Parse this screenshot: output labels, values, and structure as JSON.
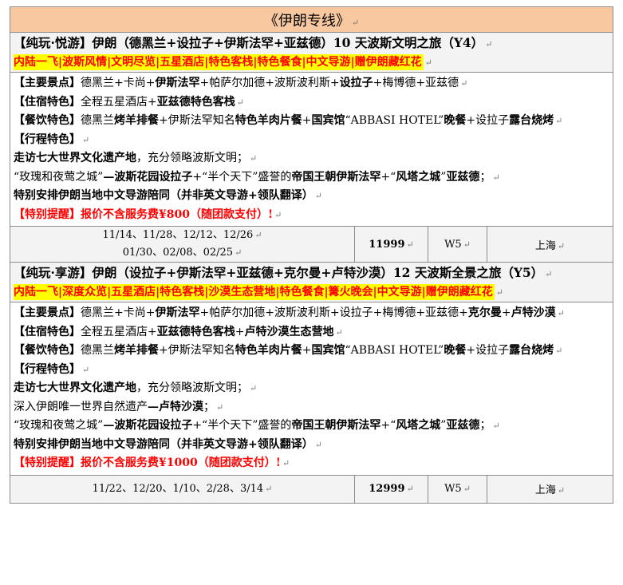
{
  "return_mark": "↵",
  "title": "《伊朗专线》",
  "tours": [
    {
      "name": "【纯玩·悦游】伊朗（德黑兰+设拉子+伊斯法罕+亚兹德）10 天波斯文明之旅（Y4）",
      "highlights": "内陆一飞|波斯风情|文明尽览|五星酒店|特色客栈|特色餐食|中文导游|赠伊朗藏红花",
      "lines": [
        {
          "parts": [
            {
              "t": "【主要景点】",
              "b": true
            },
            {
              "t": "德黑兰+卡尚+"
            },
            {
              "t": "伊斯法罕",
              "b": true
            },
            {
              "t": "+帕萨尔加德+波斯波利斯+"
            },
            {
              "t": "设拉子",
              "b": true
            },
            {
              "t": "+梅博德+亚兹德"
            }
          ]
        },
        {
          "parts": [
            {
              "t": "【住宿特色】",
              "b": true
            },
            {
              "t": "全程五星酒店+"
            },
            {
              "t": "亚兹德特色客栈",
              "b": true
            }
          ]
        },
        {
          "parts": [
            {
              "t": "【餐饮特色】",
              "b": true
            },
            {
              "t": "德黑兰"
            },
            {
              "t": "烤羊排餐",
              "b": true
            },
            {
              "t": "+伊斯法罕知名"
            },
            {
              "t": "特色羊肉片餐",
              "b": true
            },
            {
              "t": "+"
            },
            {
              "t": "国宾馆",
              "b": true
            },
            {
              "t": "“ABBASI HOTEL”"
            },
            {
              "t": "晚餐",
              "b": true
            },
            {
              "t": "+设拉子"
            },
            {
              "t": "露台烧烤",
              "b": true
            }
          ],
          "wrap": true
        },
        {
          "parts": [
            {
              "t": "【行程特色】",
              "b": true
            }
          ]
        },
        {
          "parts": [
            {
              "t": "走访七大世界文化遗产地",
              "b": true
            },
            {
              "t": "，充分领略波斯文明；"
            }
          ]
        },
        {
          "parts": [
            {
              "t": "“玫瑰和夜莺之城”"
            },
            {
              "t": "—波斯花园设拉子",
              "b": true
            },
            {
              "t": "+“半个天下”盛誉的"
            },
            {
              "t": "帝国王朝伊斯法罕",
              "b": true
            },
            {
              "t": "+“"
            },
            {
              "t": "风塔之城",
              "b": true
            },
            {
              "t": "”"
            },
            {
              "t": "亚兹德",
              "b": true
            },
            {
              "t": "；"
            }
          ]
        },
        {
          "parts": [
            {
              "t": "特别安排伊朗当地中文导游陪同（并非英文导游+领队翻译）",
              "b": true
            }
          ]
        },
        {
          "parts": [
            {
              "t": "【特别提醒】报价不含服务费¥800（随团款支付）!",
              "r": true
            }
          ]
        }
      ],
      "dates": [
        "11/14、11/28、12/12、12/26",
        "01/30、02/08、02/25"
      ],
      "price": "11999",
      "week": "W5",
      "city": "上海"
    },
    {
      "name": "【纯玩·享游】伊朗（设拉子+伊斯法罕+亚兹德+克尔曼+卢特沙漠）12 天波斯全景之旅（Y5）",
      "highlights": "内陆一飞|深度众览|五星酒店|特色客栈|沙漠生态营地|特色餐食|篝火晚会|中文导游|赠伊朗藏红花",
      "lines": [
        {
          "parts": [
            {
              "t": "【主要景点】",
              "b": true
            },
            {
              "t": "德黑兰+卡尚+"
            },
            {
              "t": "伊斯法罕",
              "b": true
            },
            {
              "t": "+帕萨尔加德+波斯波利斯+设拉子+梅博德+亚兹德+"
            },
            {
              "t": "克尔曼",
              "b": true
            },
            {
              "t": "+"
            },
            {
              "t": "卢特沙漠",
              "b": true
            }
          ]
        },
        {
          "parts": [
            {
              "t": "【住宿特色】",
              "b": true
            },
            {
              "t": "全程五星酒店+"
            },
            {
              "t": "亚兹德特色客栈",
              "b": true
            },
            {
              "t": "+"
            },
            {
              "t": "卢特沙漠生态营地",
              "b": true
            }
          ]
        },
        {
          "parts": [
            {
              "t": "【餐饮特色】",
              "b": true
            },
            {
              "t": "德黑兰"
            },
            {
              "t": "烤羊排餐",
              "b": true
            },
            {
              "t": "+伊斯法罕知名"
            },
            {
              "t": "特色羊肉片餐",
              "b": true
            },
            {
              "t": "+"
            },
            {
              "t": "国宾馆",
              "b": true
            },
            {
              "t": "“ABBASI HOTEL”"
            },
            {
              "t": "晚餐",
              "b": true
            },
            {
              "t": "+设拉子"
            },
            {
              "t": "露台烧烤",
              "b": true
            }
          ],
          "wrap": true
        },
        {
          "parts": [
            {
              "t": "【行程特色】",
              "b": true
            }
          ]
        },
        {
          "parts": [
            {
              "t": "走访七大世界文化遗产地",
              "b": true
            },
            {
              "t": "，充分领略波斯文明；"
            }
          ]
        },
        {
          "parts": [
            {
              "t": "深入伊朗唯一世界自然遗产"
            },
            {
              "t": "—卢特沙漠",
              "b": true
            },
            {
              "t": "；"
            }
          ]
        },
        {
          "parts": [
            {
              "t": "“玫瑰和夜莺之城”"
            },
            {
              "t": "—波斯花园设拉子",
              "b": true
            },
            {
              "t": "+“半个天下”盛誉的"
            },
            {
              "t": "帝国王朝伊斯法罕",
              "b": true
            },
            {
              "t": "+“"
            },
            {
              "t": "风塔之城",
              "b": true
            },
            {
              "t": "”"
            },
            {
              "t": "亚兹德",
              "b": true
            },
            {
              "t": "；"
            }
          ]
        },
        {
          "parts": [
            {
              "t": "特别安排伊朗当地中文导游陪同（并非英文导游+领队翻译）",
              "b": true
            }
          ]
        },
        {
          "parts": [
            {
              "t": "【特别提醒】报价不含服务费¥1000（随团款支付）!",
              "r": true
            }
          ]
        }
      ],
      "dates": [
        "11/22、12/20、1/10、2/28、3/14"
      ],
      "price": "12999",
      "week": "W5",
      "city": "上海"
    }
  ]
}
